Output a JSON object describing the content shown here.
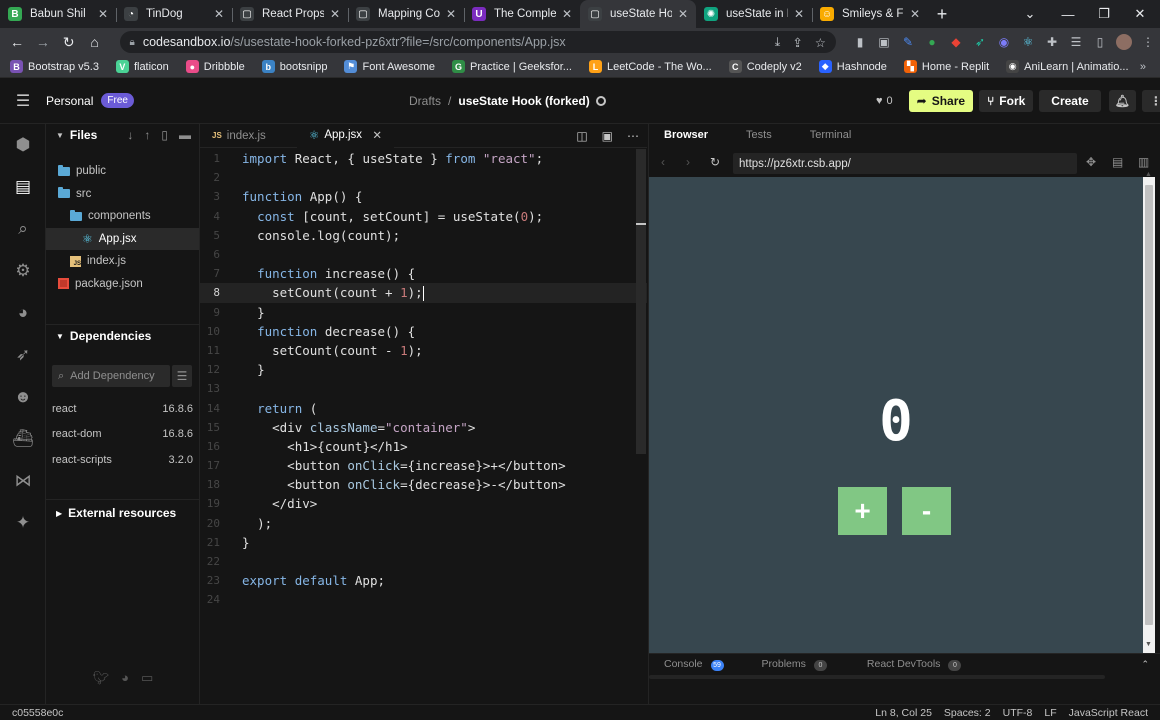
{
  "browser": {
    "tabs": [
      {
        "title": "Babun Shil",
        "fav_color": "#34a853",
        "fav_glyph": "B"
      },
      {
        "title": "TinDog",
        "fav_color": "#3c4043",
        "fav_glyph": "◔"
      },
      {
        "title": "React Props Pra",
        "fav_color": "#3c4043",
        "fav_glyph": "▢"
      },
      {
        "title": "Mapping Comp",
        "fav_color": "#3c4043",
        "fav_glyph": "▢"
      },
      {
        "title": "The Complete",
        "fav_color": "#7b2cbf",
        "fav_glyph": "U"
      },
      {
        "title": "useState Hook",
        "fav_color": "#3c4043",
        "fav_glyph": "▢",
        "active": true
      },
      {
        "title": "useState in Rea",
        "fav_color": "#10a37f",
        "fav_glyph": "✺"
      },
      {
        "title": "Smileys & F",
        "fav_color": "#f9ab00",
        "fav_glyph": "☺"
      }
    ],
    "window_controls": [
      "⌄",
      "—",
      "❐",
      "✕"
    ],
    "url_host": "codesandbox.io",
    "url_path": "/s/usestate-hook-forked-pz6xtr?file=/src/components/App.jsx",
    "bookmarks": [
      {
        "label": "Bootstrap v5.3",
        "color": "#7952b3",
        "glyph": "B"
      },
      {
        "label": "flaticon",
        "color": "#4ad295",
        "glyph": "V"
      },
      {
        "label": "Dribbble",
        "color": "#ea4c89",
        "glyph": "●"
      },
      {
        "label": "bootsnipp",
        "color": "#3b82c4",
        "glyph": "b"
      },
      {
        "label": "Font Awesome",
        "color": "#538dd7",
        "glyph": "⚑"
      },
      {
        "label": "Practice | Geeksfor...",
        "color": "#2f8d46",
        "glyph": "G"
      },
      {
        "label": "LeetCode - The Wo...",
        "color": "#ffa116",
        "glyph": "L"
      },
      {
        "label": "Codeply v2",
        "color": "#555555",
        "glyph": "C"
      },
      {
        "label": "Hashnode",
        "color": "#2962ff",
        "glyph": "◆"
      },
      {
        "label": "Home - Replit",
        "color": "#f26207",
        "glyph": "▚"
      },
      {
        "label": "AniLearn | Animatio...",
        "color": "#444444",
        "glyph": "◉"
      }
    ]
  },
  "csb": {
    "workspace": "Personal",
    "plan_badge": "Free",
    "breadcrumb_root": "Drafts",
    "breadcrumb_sep": "/",
    "sandbox_title": "useState Hook (forked)",
    "likes": "0",
    "share_label": "Share",
    "fork_label": "Fork",
    "create_label": "Create"
  },
  "sidebar": {
    "files_heading": "Files",
    "tree": [
      {
        "name": "public",
        "type": "folder",
        "indent": 0
      },
      {
        "name": "src",
        "type": "folder",
        "indent": 0
      },
      {
        "name": "components",
        "type": "folder",
        "indent": 1
      },
      {
        "name": "App.jsx",
        "type": "react",
        "indent": 2,
        "selected": true
      },
      {
        "name": "index.js",
        "type": "js",
        "indent": 1
      },
      {
        "name": "package.json",
        "type": "pkg",
        "indent": 0
      }
    ],
    "deps_heading": "Dependencies",
    "add_dep_placeholder": "Add Dependency",
    "dependencies": [
      {
        "name": "react",
        "version": "16.8.6"
      },
      {
        "name": "react-dom",
        "version": "16.8.6"
      },
      {
        "name": "react-scripts",
        "version": "3.2.0"
      }
    ],
    "external_heading": "External resources"
  },
  "editor": {
    "tabs": [
      {
        "label": "index.js",
        "active": false
      },
      {
        "label": "App.jsx",
        "active": true
      }
    ],
    "current_line": 8,
    "lines": [
      "import React, { useState } from \"react\";",
      "",
      "function App() {",
      "  const [count, setCount] = useState(0);",
      "  console.log(count);",
      "",
      "  function increase() {",
      "    setCount(count + 1);",
      "  }",
      "  function decrease() {",
      "    setCount(count - 1);",
      "  }",
      "",
      "  return (",
      "    <div className=\"container\">",
      "      <h1>{count}</h1>",
      "      <button onClick={increase}>+</button>",
      "      <button onClick={decrease}>-</button>",
      "    </div>",
      "  );",
      "}",
      "",
      "export default App;",
      ""
    ]
  },
  "preview": {
    "tabs": [
      "Browser",
      "Tests",
      "Terminal"
    ],
    "url": "https://pz6xtr.csb.app/",
    "count": "0",
    "plus_label": "+",
    "minus_label": "-",
    "console_label": "Console",
    "console_count": "59",
    "problems_label": "Problems",
    "problems_count": "0",
    "devtools_label": "React DevTools",
    "devtools_count": "0"
  },
  "status": {
    "commit": "c05558e0c",
    "position": "Ln 8, Col 25",
    "spaces": "Spaces: 2",
    "encoding": "UTF-8",
    "eol": "LF",
    "language": "JavaScript React"
  }
}
